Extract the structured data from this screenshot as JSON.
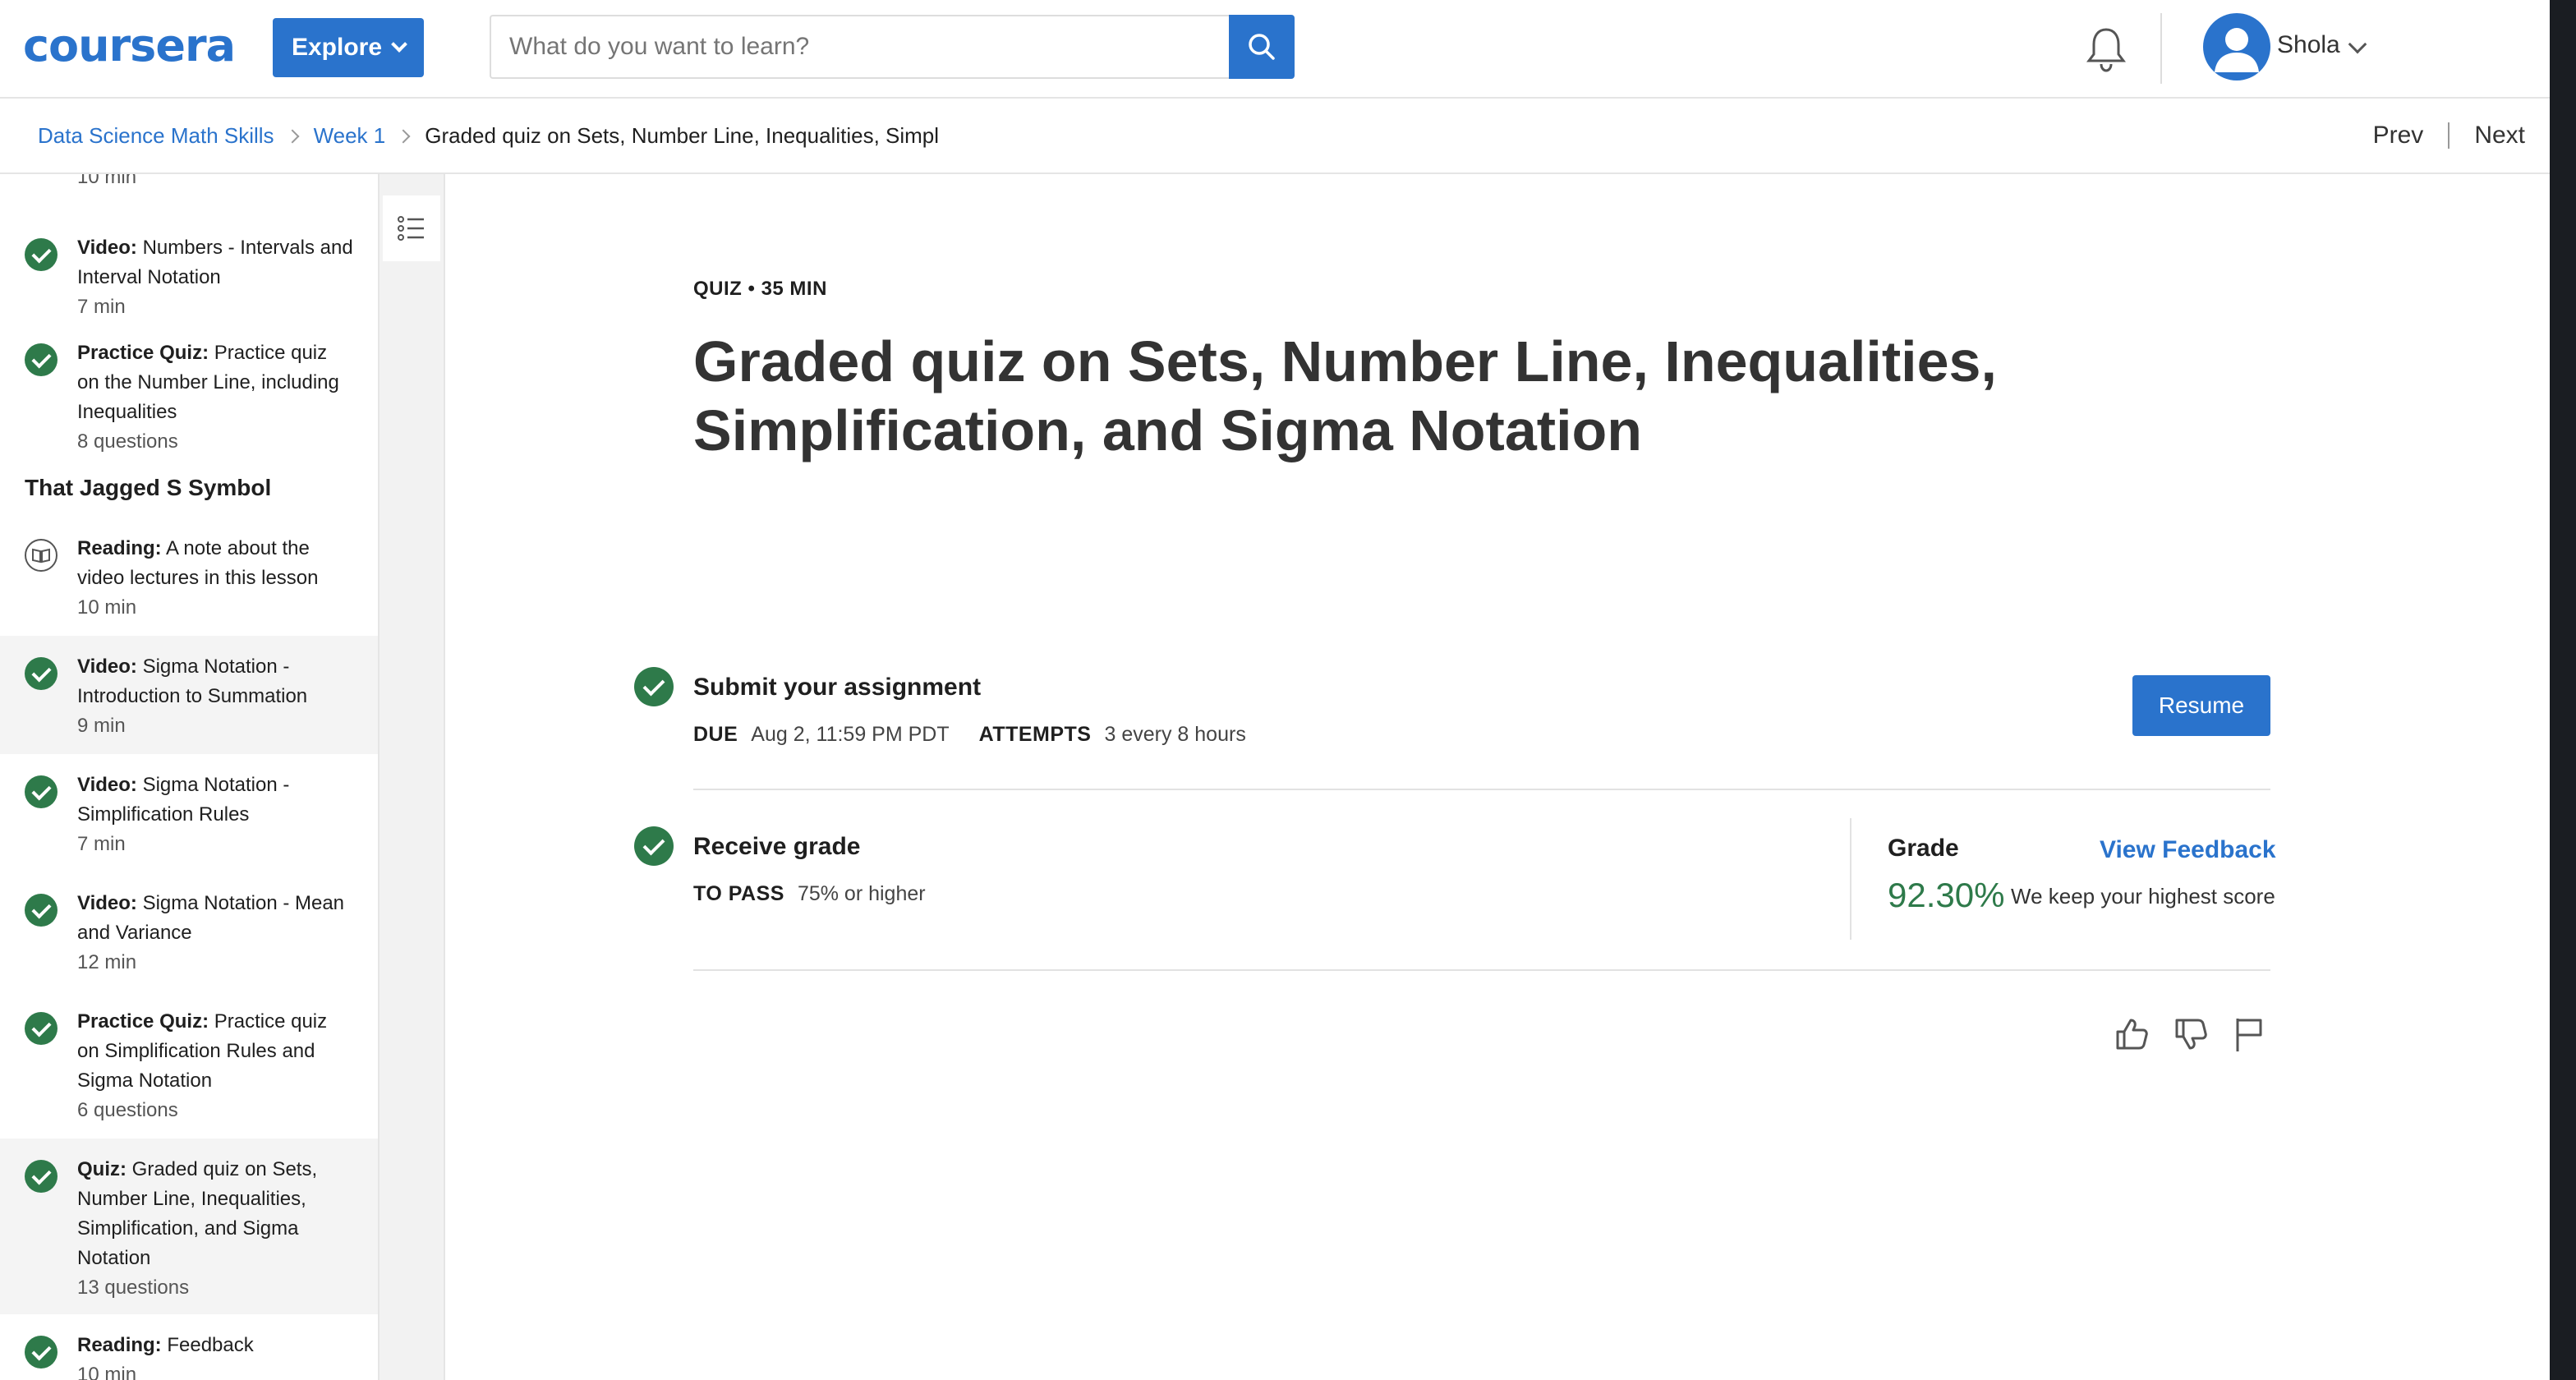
{
  "header": {
    "logo": "coursera",
    "explore_label": "Explore",
    "search_placeholder": "What do you want to learn?",
    "username": "Shola"
  },
  "breadcrumb": {
    "items": [
      "Data Science Math Skills",
      "Week 1"
    ],
    "current": "Graded quiz on Sets, Number Line, Inequalities, Simpl",
    "prev": "Prev",
    "next": "Next"
  },
  "sidebar": {
    "partial_top": "10 min",
    "section": "That Jagged S Symbol",
    "items": [
      {
        "type": "Video:",
        "title": "Numbers - Intervals and Interval Notation",
        "meta": "7 min"
      },
      {
        "type": "Practice Quiz:",
        "title": "Practice quiz on the Number Line, including Inequalities",
        "meta": "8 questions"
      },
      {
        "type": "Reading:",
        "title": "A note about the video lectures in this lesson",
        "meta": "10 min"
      },
      {
        "type": "Video:",
        "title": "Sigma Notation - Introduction to Summation",
        "meta": "9 min"
      },
      {
        "type": "Video:",
        "title": "Sigma Notation - Simplification Rules",
        "meta": "7 min"
      },
      {
        "type": "Video:",
        "title": "Sigma Notation - Mean and Variance",
        "meta": "12 min"
      },
      {
        "type": "Practice Quiz:",
        "title": "Practice quiz on Simplification Rules and Sigma Notation",
        "meta": "6 questions"
      },
      {
        "type": "Quiz:",
        "title": "Graded quiz on Sets, Number Line, Inequalities, Simplification, and Sigma Notation",
        "meta": "13 questions"
      },
      {
        "type": "Reading:",
        "title": "Feedback",
        "meta": "10 min"
      }
    ]
  },
  "main": {
    "kicker": "QUIZ • 35 MIN",
    "title": "Graded quiz on Sets, Number Line, Inequalities, Simplification, and Sigma Notation",
    "submit": {
      "title": "Submit your assignment",
      "due_label": "DUE",
      "due_value": "Aug 2, 11:59 PM PDT",
      "attempts_label": "ATTEMPTS",
      "attempts_value": "3 every 8 hours",
      "resume_label": "Resume"
    },
    "receive": {
      "title": "Receive grade",
      "pass_label": "TO PASS",
      "pass_value": "75% or higher",
      "grade_label": "Grade",
      "grade_value": "92.30%",
      "grade_note": "We keep your highest score",
      "view_feedback": "View Feedback"
    }
  },
  "colors": {
    "brand_blue": "#2a73cc",
    "success_green": "#2e7a4a",
    "text_dark": "#1f1f1f"
  },
  "icons": [
    "search-icon",
    "bell-icon",
    "avatar-icon",
    "chevron-down-icon",
    "check-circle-icon",
    "book-icon",
    "list-icon",
    "thumbs-up-icon",
    "thumbs-down-icon",
    "flag-icon"
  ]
}
